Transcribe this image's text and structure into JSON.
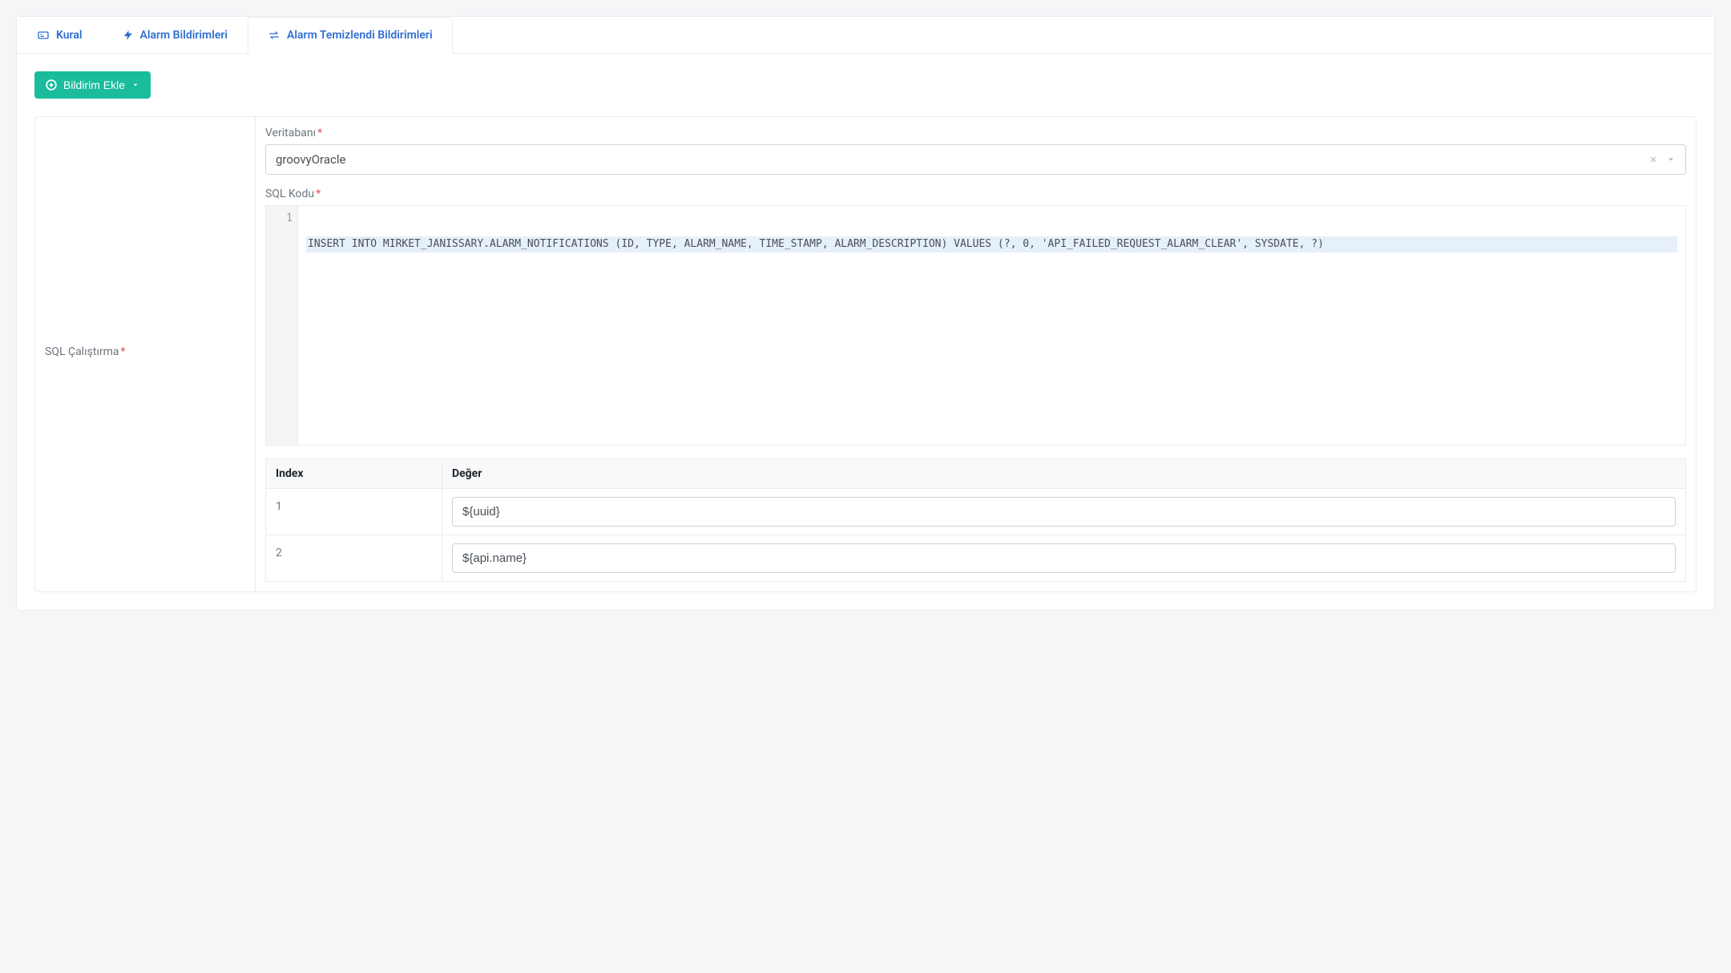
{
  "tabs": {
    "rule": "Kural",
    "alarm_notifications": "Alarm Bildirimleri",
    "alarm_cleared_notifications": "Alarm Temizlendi Bildirimleri"
  },
  "buttons": {
    "add_notification": "Bildirim Ekle"
  },
  "form": {
    "sql_run_label": "SQL Çalıştırma",
    "database_label": "Veritabanı",
    "database_value": "groovyOracle",
    "sql_code_label": "SQL Kodu",
    "sql_code_value": "INSERT INTO MIRKET_JANISSARY.ALARM_NOTIFICATIONS (ID, TYPE, ALARM_NAME, TIME_STAMP, ALARM_DESCRIPTION) VALUES (?, 0, 'API_FAILED_REQUEST_ALARM_CLEAR', SYSDATE, ?)",
    "gutter_line": "1"
  },
  "params_table": {
    "header_index": "Index",
    "header_value": "Değer",
    "rows": [
      {
        "index": "1",
        "value": "${uuid}"
      },
      {
        "index": "2",
        "value": "${api.name}"
      }
    ]
  }
}
